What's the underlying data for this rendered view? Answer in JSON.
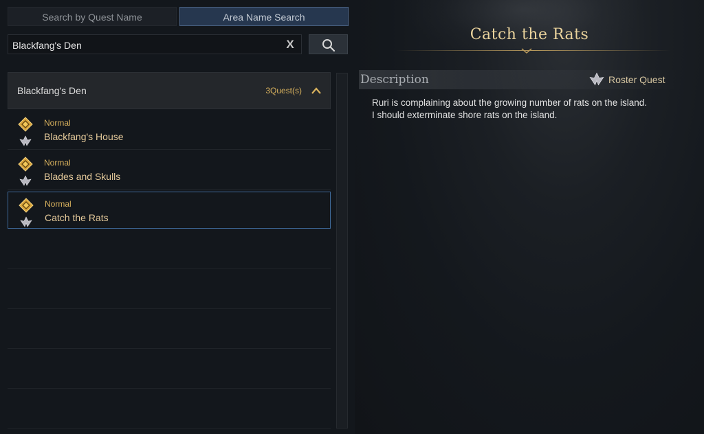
{
  "tabs": {
    "quest_name": "Search by Quest Name",
    "area_name": "Area Name Search"
  },
  "search": {
    "value": "Blackfang's Den",
    "clear_label": "X"
  },
  "group": {
    "title": "Blackfang's Den",
    "count": "3Quest(s)"
  },
  "quests": [
    {
      "type": "Normal",
      "name": "Blackfang's House"
    },
    {
      "type": "Normal",
      "name": "Blades and Skulls"
    },
    {
      "type": "Normal",
      "name": "Catch the Rats"
    }
  ],
  "detail": {
    "title": "Catch the Rats",
    "description_label": "Description",
    "tag": "Roster Quest",
    "description_lines": [
      "Ruri is complaining about the growing number of rats on the island.",
      "I should exterminate shore rats on the island."
    ]
  },
  "colors": {
    "gold": "#d9b25e",
    "title_gold": "#ead39c",
    "selected_border": "#3f6a9a",
    "active_tab": "#26374f"
  },
  "icons": {
    "quest_type": "gold-diamond-icon",
    "roster": "roster-emblem-icon",
    "search": "magnifier-icon",
    "collapse": "chevron-up-icon"
  }
}
